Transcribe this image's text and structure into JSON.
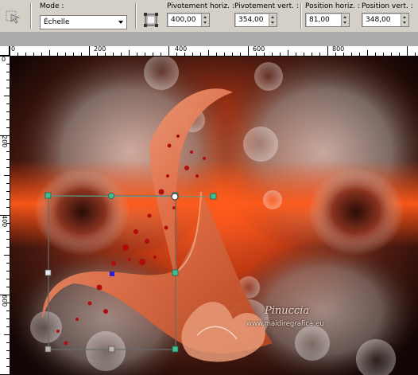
{
  "toolbar": {
    "mode_label": "Mode :",
    "mode_value": "Échelle",
    "pivot_h_label": "Pivotement horiz. :",
    "pivot_h_value": "400,00",
    "pivot_v_label": "Pivotement vert. :",
    "pivot_v_value": "354,00",
    "pos_h_label": "Position horiz. :",
    "pos_h_value": "81,00",
    "pos_v_label": "Position vert. :",
    "pos_v_value": "348,00"
  },
  "ruler": {
    "top_ticks": [
      "0",
      "200",
      "400",
      "600",
      "800"
    ],
    "left_ticks": [
      "0",
      "200",
      "400",
      "600"
    ]
  },
  "canvas": {
    "watermark_name": "Pinuccia",
    "watermark_url": "www.maidiregrafica.eu"
  },
  "colors": {
    "accent": "#ff5a1a",
    "handle": "#3fbf8f",
    "pivot": "#2a1ed8"
  }
}
